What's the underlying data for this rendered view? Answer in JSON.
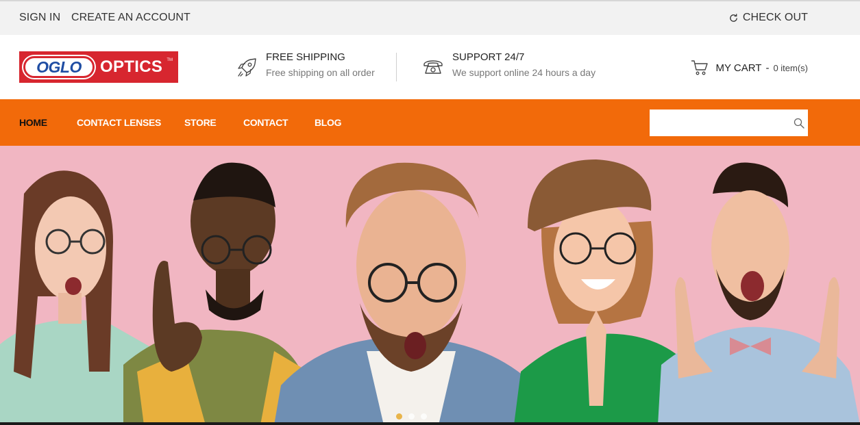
{
  "topbar": {
    "sign_in": "SIGN IN",
    "create_account": "CREATE AN ACCOUNT",
    "checkout": "CHECK OUT"
  },
  "logo": {
    "oglo": "OGLO",
    "optics": "OPTICS",
    "tm": "TM"
  },
  "features": {
    "shipping": {
      "title": "FREE SHIPPING",
      "desc": "Free shipping on all order",
      "icon": "rocket-icon"
    },
    "support": {
      "title": "SUPPORT 24/7",
      "desc": "We support online 24 hours a day",
      "icon": "telephone-icon"
    }
  },
  "cart": {
    "label": "MY CART",
    "separator": "-",
    "count": "0 item(s)",
    "icon": "cart-icon"
  },
  "nav": {
    "items": [
      "HOME",
      "CONTACT LENSES",
      "STORE",
      "CONTACT",
      "BLOG"
    ],
    "active": "HOME"
  },
  "search": {
    "placeholder": "",
    "value": "",
    "icon": "search-icon"
  },
  "slider": {
    "slide_count": 3,
    "active_index": 0
  },
  "colors": {
    "topbar_bg": "#f2f2f2",
    "nav_bg": "#f26a0a",
    "logo_red": "#d7262f",
    "logo_blue": "#1f4da3",
    "hero_bg": "#f1b6c2"
  }
}
